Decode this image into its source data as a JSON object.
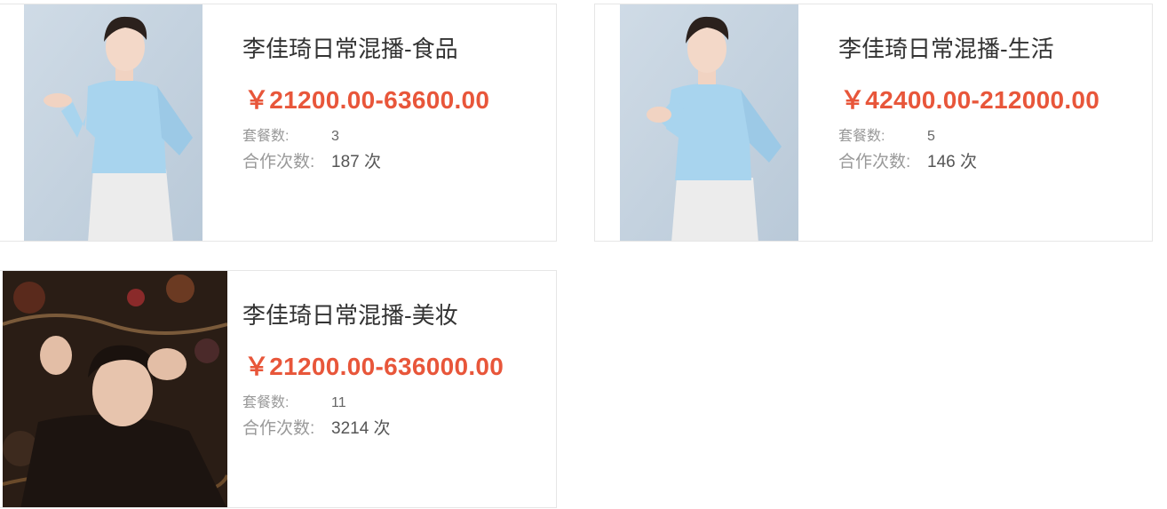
{
  "labels": {
    "package_count": "套餐数:",
    "cooperation_count": "合作次数:"
  },
  "colors": {
    "price": "#e8563a",
    "title": "#333333",
    "label": "#999999",
    "shirt": "#a8d4ee",
    "pants": "#ececec",
    "photo_bg_light": "#c9d6e2",
    "photo_bg_dark": "#2a1d15"
  },
  "cards": [
    {
      "title": "李佳琦日常混播-食品",
      "price": "￥21200.00-63600.00",
      "package_count": "3",
      "cooperation_count": "187 次",
      "photo": "portrait-blue-shirt-open-hand"
    },
    {
      "title": "李佳琦日常混播-生活",
      "price": "￥42400.00-212000.00",
      "package_count": "5",
      "cooperation_count": "146 次",
      "photo": "portrait-blue-shirt-blowing-kiss"
    },
    {
      "title": "李佳琦日常混播-美妆",
      "price": "￥21200.00-636000.00",
      "package_count": "11",
      "cooperation_count": "3214 次",
      "photo": "portrait-lying-on-patterned-carpet"
    }
  ]
}
